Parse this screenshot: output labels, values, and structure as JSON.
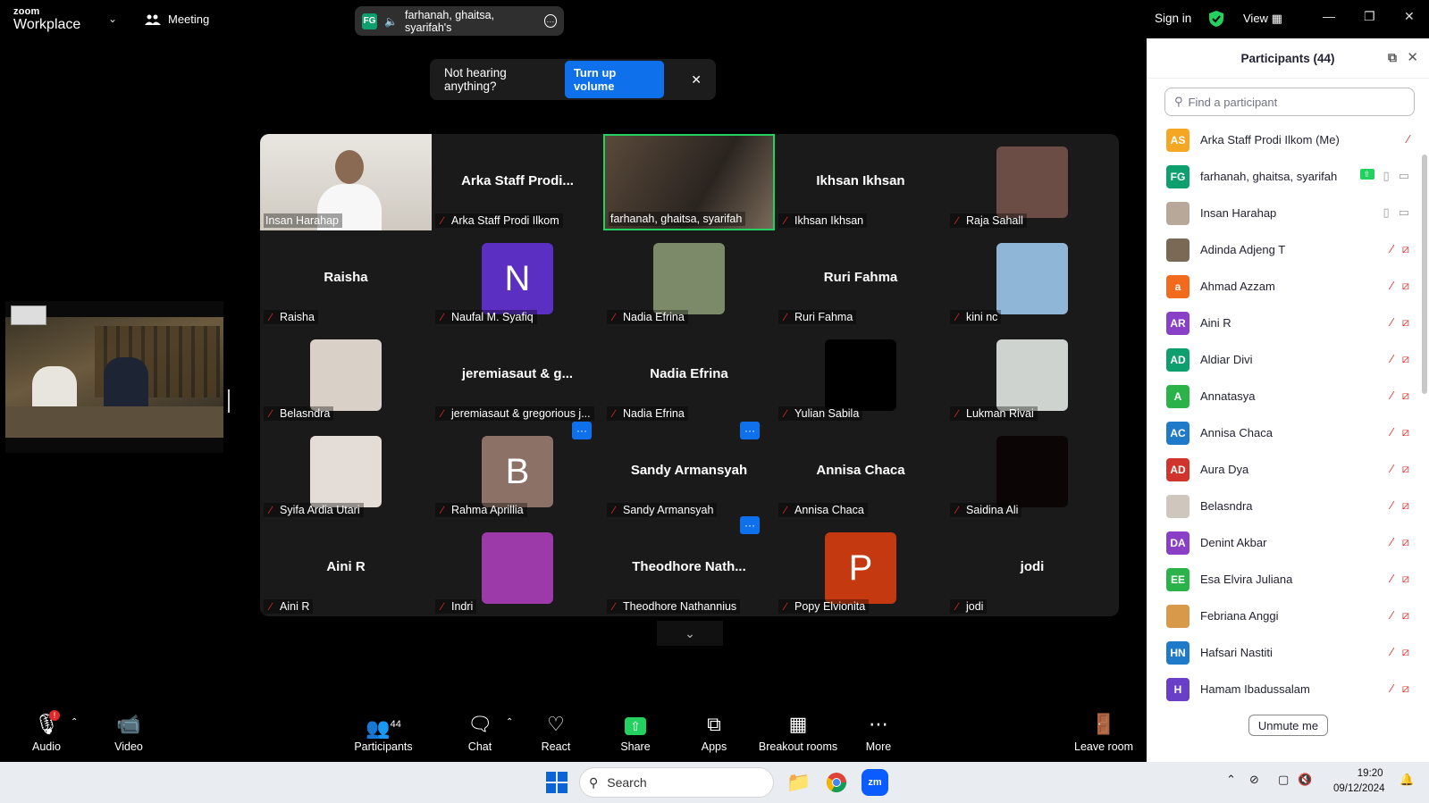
{
  "topbar": {
    "logo_small": "zoom",
    "logo_big": "Workplace",
    "meeting_label": "Meeting",
    "share_badge": "FG",
    "share_text": "farhanah, ghaitsa, syarifah's",
    "signin": "Sign in",
    "view": "View"
  },
  "notice": {
    "text": "Not hearing anything?",
    "button": "Turn up volume"
  },
  "tiles": [
    {
      "center": "",
      "label": "Insan Harahap",
      "muted": false,
      "avatar": "photo",
      "color": "#bfb6a8"
    },
    {
      "center": "Arka  Staff Prodi...",
      "label": "Arka Staff Prodi Ilkom",
      "muted": true,
      "avatar": "none",
      "color": ""
    },
    {
      "center": "",
      "label": "farhanah, ghaitsa, syarifah",
      "muted": false,
      "avatar": "photo-wide",
      "color": "#4a4034"
    },
    {
      "center": "Ikhsan Ikhsan",
      "label": "Ikhsan Ikhsan",
      "muted": true,
      "avatar": "none",
      "color": ""
    },
    {
      "center": "",
      "label": "Raja Sahall",
      "muted": true,
      "avatar": "photo",
      "color": "#6b4d45"
    },
    {
      "center": "Raisha",
      "label": "Raisha",
      "muted": true,
      "avatar": "none",
      "color": ""
    },
    {
      "center": "",
      "label": "Naufal M. Syafiq",
      "muted": true,
      "avatar": "letter",
      "letter": "N",
      "color": "#5a2fc2"
    },
    {
      "center": "",
      "label": "Nadia Efrina",
      "muted": true,
      "avatar": "photo",
      "color": "#7c8a6a"
    },
    {
      "center": "Ruri Fahma",
      "label": "Ruri Fahma",
      "muted": true,
      "avatar": "none",
      "color": ""
    },
    {
      "center": "",
      "label": "kini nc",
      "muted": true,
      "avatar": "photo",
      "color": "#8fb6d6"
    },
    {
      "center": "",
      "label": "Belasndra",
      "muted": true,
      "avatar": "photo",
      "color": "#d9d0c8"
    },
    {
      "center": "jeremiasaut  &  g...",
      "label": "jeremiasaut & gregorious j...",
      "muted": true,
      "avatar": "none",
      "color": ""
    },
    {
      "center": "Nadia Efrina",
      "label": "Nadia Efrina",
      "muted": true,
      "avatar": "none",
      "color": ""
    },
    {
      "center": "",
      "label": "Yulian Sabila",
      "muted": true,
      "avatar": "photo",
      "color": "#000000"
    },
    {
      "center": "",
      "label": "Lukman Rivai",
      "muted": true,
      "avatar": "photo",
      "color": "#cfd3d0"
    },
    {
      "center": "",
      "label": "Syifa Ardia Utari",
      "muted": true,
      "avatar": "photo",
      "color": "#e4dcd6"
    },
    {
      "center": "",
      "label": "Rahma Aprillia",
      "muted": true,
      "avatar": "letter",
      "letter": "B",
      "color": "#8c7266"
    },
    {
      "center": "Sandy Armansyah",
      "label": "Sandy Armansyah",
      "muted": true,
      "avatar": "none",
      "color": ""
    },
    {
      "center": "Annisa Chaca",
      "label": "Annisa Chaca",
      "muted": true,
      "avatar": "none",
      "color": ""
    },
    {
      "center": "",
      "label": "Saidina Ali",
      "muted": true,
      "avatar": "photo",
      "color": "#0b0505"
    },
    {
      "center": "Aini R",
      "label": "Aini R",
      "muted": true,
      "avatar": "none",
      "color": ""
    },
    {
      "center": "",
      "label": "Indri",
      "muted": true,
      "avatar": "photo",
      "color": "#9b3aa8"
    },
    {
      "center": "Theodhore  Nath...",
      "label": "Theodhore Nathannius",
      "muted": true,
      "avatar": "none",
      "color": ""
    },
    {
      "center": "",
      "label": "Popy Elvionita",
      "muted": true,
      "avatar": "letter",
      "letter": "P",
      "color": "#c4390f"
    },
    {
      "center": "jodi",
      "label": "jodi",
      "muted": true,
      "avatar": "none",
      "color": ""
    }
  ],
  "dots_label": "···",
  "panel": {
    "title": "Participants (44)",
    "search_placeholder": "Find a participant",
    "unmute": "Unmute me",
    "participants": [
      {
        "initials": "AS",
        "name": "Arka Staff Prodi Ilkom (Me)",
        "color": "#f5a623",
        "icons": "mute-only"
      },
      {
        "initials": "FG",
        "name": "farhanah, ghaitsa, syarifah",
        "color": "#0e9f6e",
        "icons": "share-mic-video"
      },
      {
        "initials": "",
        "name": "Insan Harahap",
        "color": "#b8a89a",
        "icons": "mic-video"
      },
      {
        "initials": "",
        "name": "Adinda Adjeng T",
        "color": "#7a6a55",
        "icons": "muted"
      },
      {
        "initials": "a",
        "name": "Ahmad Azzam",
        "color": "#f26b1d",
        "icons": "muted"
      },
      {
        "initials": "AR",
        "name": "Aini R",
        "color": "#8a3fc7",
        "icons": "muted"
      },
      {
        "initials": "AD",
        "name": "Aldiar Divi",
        "color": "#0e9f6e",
        "icons": "muted"
      },
      {
        "initials": "A",
        "name": "Annatasya",
        "color": "#2bb34a",
        "icons": "muted"
      },
      {
        "initials": "AC",
        "name": "Annisa Chaca",
        "color": "#1f7ac9",
        "icons": "muted"
      },
      {
        "initials": "AD",
        "name": "Aura Dya",
        "color": "#d0342c",
        "icons": "muted"
      },
      {
        "initials": "",
        "name": "Belasndra",
        "color": "#cfc6bd",
        "icons": "muted"
      },
      {
        "initials": "DA",
        "name": "Denint Akbar",
        "color": "#8a3fc7",
        "icons": "muted"
      },
      {
        "initials": "EE",
        "name": "Esa Elvira Juliana",
        "color": "#2bb34a",
        "icons": "muted"
      },
      {
        "initials": "",
        "name": "Febriana Anggi",
        "color": "#d89a4a",
        "icons": "muted"
      },
      {
        "initials": "HN",
        "name": "Hafsari Nastiti",
        "color": "#1f7ac9",
        "icons": "muted"
      },
      {
        "initials": "H",
        "name": "Hamam Ibadussalam",
        "color": "#6a3fc7",
        "icons": "muted"
      }
    ]
  },
  "toolbar": {
    "audio": "Audio",
    "video": "Video",
    "participants": "Participants",
    "participants_count": "44",
    "chat": "Chat",
    "react": "React",
    "share": "Share",
    "apps": "Apps",
    "breakout": "Breakout rooms",
    "more": "More",
    "leave": "Leave room",
    "audio_badge": "!"
  },
  "taskbar": {
    "search": "Search",
    "time": "19:20",
    "date": "09/12/2024"
  }
}
